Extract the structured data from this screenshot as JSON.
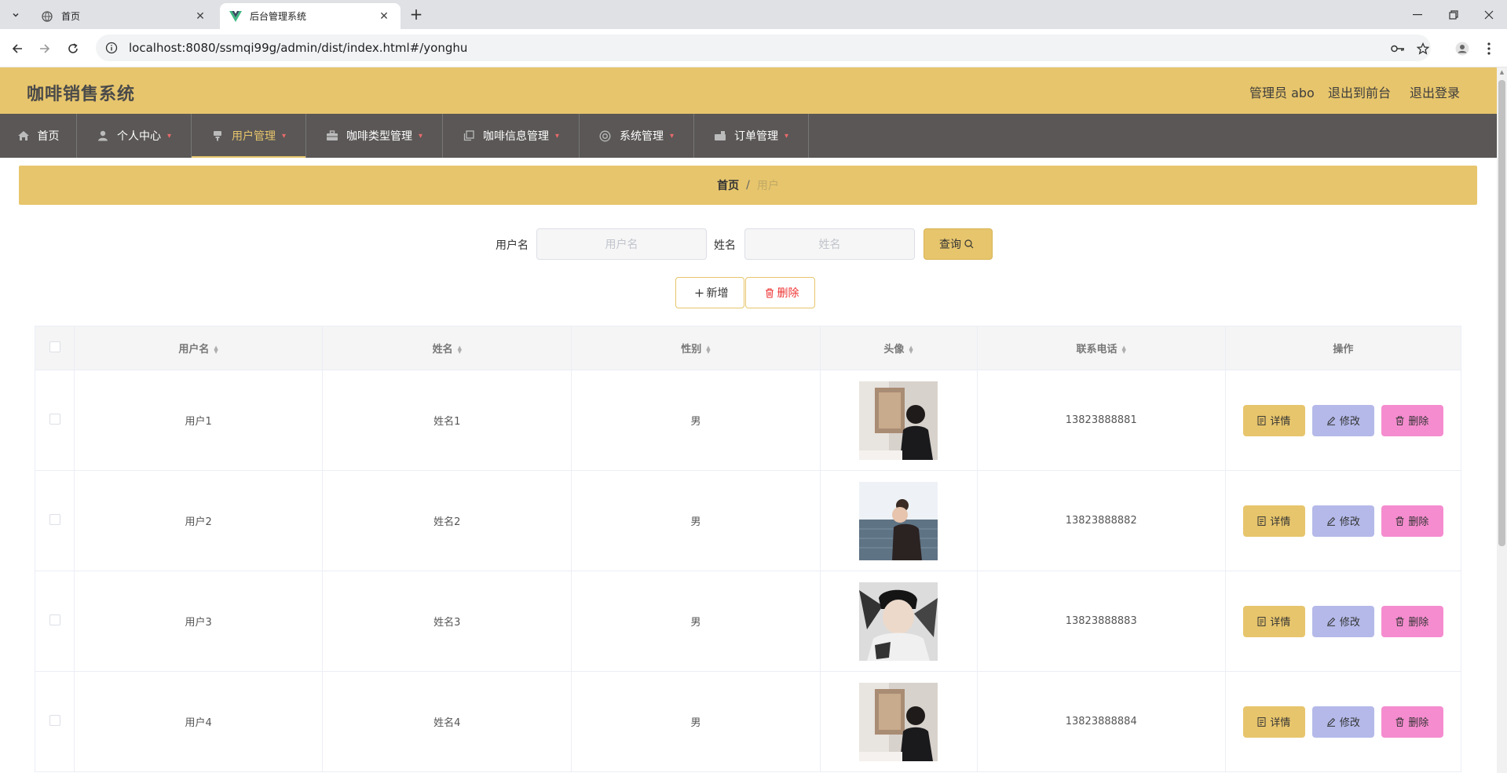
{
  "browser": {
    "tabs": [
      {
        "title": "首页",
        "icon": "globe-icon"
      },
      {
        "title": "后台管理系统",
        "icon": "vue-logo-icon"
      }
    ],
    "url": "localhost:8080/ssmqi99g/admin/dist/index.html#/yonghu"
  },
  "header": {
    "title": "咖啡销售系统",
    "admin_label": "管理员 abo",
    "to_front": "退出到前台",
    "logout": "退出登录"
  },
  "nav": {
    "items": [
      {
        "label": "首页",
        "icon": "home-icon"
      },
      {
        "label": "个人中心",
        "icon": "user-icon",
        "dropdown": true
      },
      {
        "label": "用户管理",
        "icon": "user-manage-icon",
        "dropdown": true,
        "active": true
      },
      {
        "label": "咖啡类型管理",
        "icon": "briefcase-icon",
        "dropdown": true
      },
      {
        "label": "咖啡信息管理",
        "icon": "copy-icon",
        "dropdown": true
      },
      {
        "label": "系统管理",
        "icon": "system-icon",
        "dropdown": true
      },
      {
        "label": "订单管理",
        "icon": "order-icon",
        "dropdown": true
      }
    ]
  },
  "breadcrumb": {
    "home": "首页",
    "separator": "/",
    "current": "用户"
  },
  "search": {
    "username_label": "用户名",
    "username_placeholder": "用户名",
    "name_label": "姓名",
    "name_placeholder": "姓名",
    "query_label": "查询"
  },
  "actions": {
    "add_label": "新增",
    "delete_label": "删除"
  },
  "table": {
    "headers": {
      "username": "用户名",
      "name": "姓名",
      "gender": "性别",
      "avatar": "头像",
      "phone": "联系电话",
      "ops": "操作"
    },
    "op_labels": {
      "detail": "详情",
      "edit": "修改",
      "delete": "删除"
    },
    "rows": [
      {
        "username": "用户1",
        "name": "姓名1",
        "gender": "男",
        "phone": "13823888881"
      },
      {
        "username": "用户2",
        "name": "姓名2",
        "gender": "男",
        "phone": "13823888882"
      },
      {
        "username": "用户3",
        "name": "姓名3",
        "gender": "男",
        "phone": "13823888883"
      },
      {
        "username": "用户4",
        "name": "姓名4",
        "gender": "男",
        "phone": "13823888884"
      }
    ]
  },
  "colors": {
    "accent": "#e7c56c",
    "nav_bg": "#5a5756",
    "edit_btn": "#b4b9e9",
    "delete_btn": "#f58ccf"
  }
}
